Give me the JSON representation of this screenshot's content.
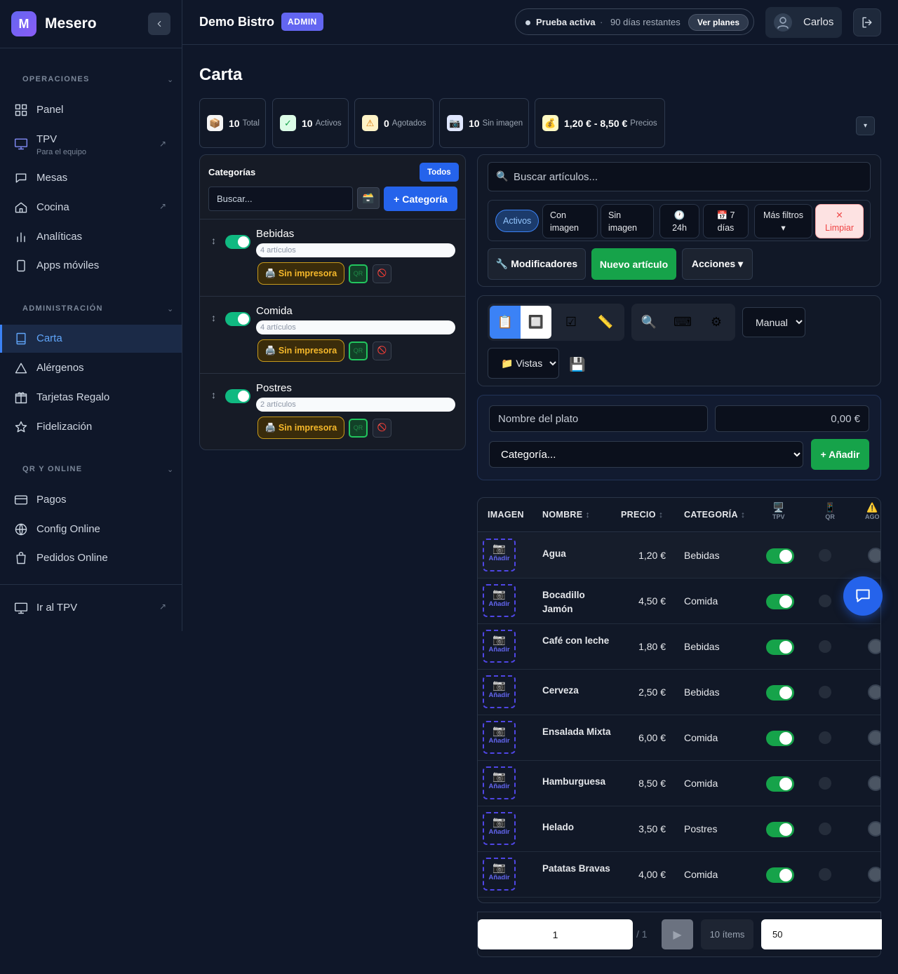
{
  "brand": {
    "logo_letter": "M",
    "name": "Mesero"
  },
  "sidebar": {
    "sections": [
      {
        "label": "OPERACIONES"
      },
      {
        "label": "ADMINISTRACIÓN"
      },
      {
        "label": "QR Y ONLINE"
      }
    ],
    "items": [
      {
        "label": "Panel",
        "icon": "grid-icon"
      },
      {
        "label": "TPV",
        "sub": "Para el equipo",
        "icon": "monitor-icon",
        "external": true
      },
      {
        "label": "Mesas",
        "icon": "table-icon"
      },
      {
        "label": "Cocina",
        "icon": "home-icon",
        "external": true
      },
      {
        "label": "Analíticas",
        "icon": "bar-chart-icon"
      },
      {
        "label": "Apps móviles",
        "icon": "phone-icon"
      },
      {
        "label": "Carta",
        "icon": "book-icon",
        "active": true
      },
      {
        "label": "Alérgenos",
        "icon": "warning-icon"
      },
      {
        "label": "Tarjetas Regalo",
        "icon": "gift-icon"
      },
      {
        "label": "Fidelización",
        "icon": "star-icon"
      },
      {
        "label": "Pagos",
        "icon": "card-icon"
      },
      {
        "label": "Config Online",
        "icon": "globe-icon"
      },
      {
        "label": "Pedidos Online",
        "icon": "bag-icon"
      }
    ],
    "footer": {
      "label": "Ir al TPV",
      "icon": "monitor-icon"
    }
  },
  "header": {
    "business": "Demo Bistro",
    "badge": "ADMIN",
    "trial_status": "Prueba activa",
    "trial_sep": "·",
    "trial_days": "90 días restantes",
    "plans_button": "Ver planes",
    "user_name": "Carlos"
  },
  "page": {
    "title": "Carta"
  },
  "stats": [
    {
      "emoji": "📦",
      "value": "10",
      "label": "Total"
    },
    {
      "emoji": "✓",
      "value": "10",
      "label": "Activos"
    },
    {
      "emoji": "⚠",
      "value": "0",
      "label": "Agotados"
    },
    {
      "emoji": "📷",
      "value": "10",
      "label": "Sin imagen"
    },
    {
      "emoji": "💰",
      "value": "1,20 € - 8,50 €",
      "label": "Precios"
    }
  ],
  "stats_toggle": "▾",
  "categories_panel": {
    "title": "Categorías",
    "all_button": "Todos",
    "search_placeholder": "Buscar...",
    "add_button": "+ Categoría",
    "printer_label": "Sin impresora",
    "qr_label": "QR",
    "items": [
      {
        "name": "Bebidas",
        "count": "4 artículos",
        "enabled": true
      },
      {
        "name": "Comida",
        "count": "4 artículos",
        "enabled": true
      },
      {
        "name": "Postres",
        "count": "2 artículos",
        "enabled": true
      }
    ]
  },
  "filters": {
    "search_placeholder": "Buscar artículos...",
    "chips": [
      {
        "label": "Activos",
        "active": true
      },
      {
        "label": "Con imagen"
      },
      {
        "label": "Sin imagen"
      },
      {
        "label": "🕐 24h"
      },
      {
        "label": "📅 7 días"
      },
      {
        "label": "Más filtros ▾"
      },
      {
        "label": "✕ Limpiar"
      }
    ],
    "modifiers_button": "🔧 Modificadores",
    "new_item_button": "Nuevo artículo",
    "actions_button": "Acciones ▾"
  },
  "view": {
    "sort_mode": "Manual",
    "views_select": "📁 Vistas",
    "view_buttons": [
      "📋",
      "🔲",
      "☑",
      "📏"
    ],
    "tool_buttons": [
      "🔍",
      "⌨",
      "⚙"
    ],
    "save_icon": "💾"
  },
  "quick_add": {
    "name_placeholder": "Nombre del plato",
    "price_placeholder": "0,00 €",
    "category_placeholder": "Categoría...",
    "add_button": "+ Añadir"
  },
  "table": {
    "columns": {
      "image": "IMAGEN",
      "name": "NOMBRE",
      "price": "PRECIO",
      "category": "CATEGORÍA",
      "tpv": "TPV",
      "qr": "QR",
      "agotado": "AGO"
    },
    "sort_glyph": "↕",
    "image_add": "Añadir",
    "rows": [
      {
        "name": "Agua",
        "price": "1,20 €",
        "category": "Bebidas",
        "tpv": true
      },
      {
        "name": "Bocadillo Jamón",
        "price": "4,50 €",
        "category": "Comida",
        "tpv": true
      },
      {
        "name": "Café con leche",
        "price": "1,80 €",
        "category": "Bebidas",
        "tpv": true
      },
      {
        "name": "Cerveza",
        "price": "2,50 €",
        "category": "Bebidas",
        "tpv": true
      },
      {
        "name": "Ensalada Mixta",
        "price": "6,00 €",
        "category": "Comida",
        "tpv": true
      },
      {
        "name": "Hamburguesa",
        "price": "8,50 €",
        "category": "Comida",
        "tpv": true
      },
      {
        "name": "Helado",
        "price": "3,50 €",
        "category": "Postres",
        "tpv": true
      },
      {
        "name": "Patatas Bravas",
        "price": "4,00 €",
        "category": "Comida",
        "tpv": true
      }
    ]
  },
  "pagination": {
    "page": "1",
    "total": "/ 1",
    "next": "▶",
    "count": "10 ítems",
    "page_size": "50"
  },
  "colors": {
    "accent": "#2563eb",
    "success": "#16a34a",
    "toggle_on": "#10b981",
    "warning": "#f5b82a",
    "danger": "#ef4444",
    "brand": "#6366f1"
  }
}
